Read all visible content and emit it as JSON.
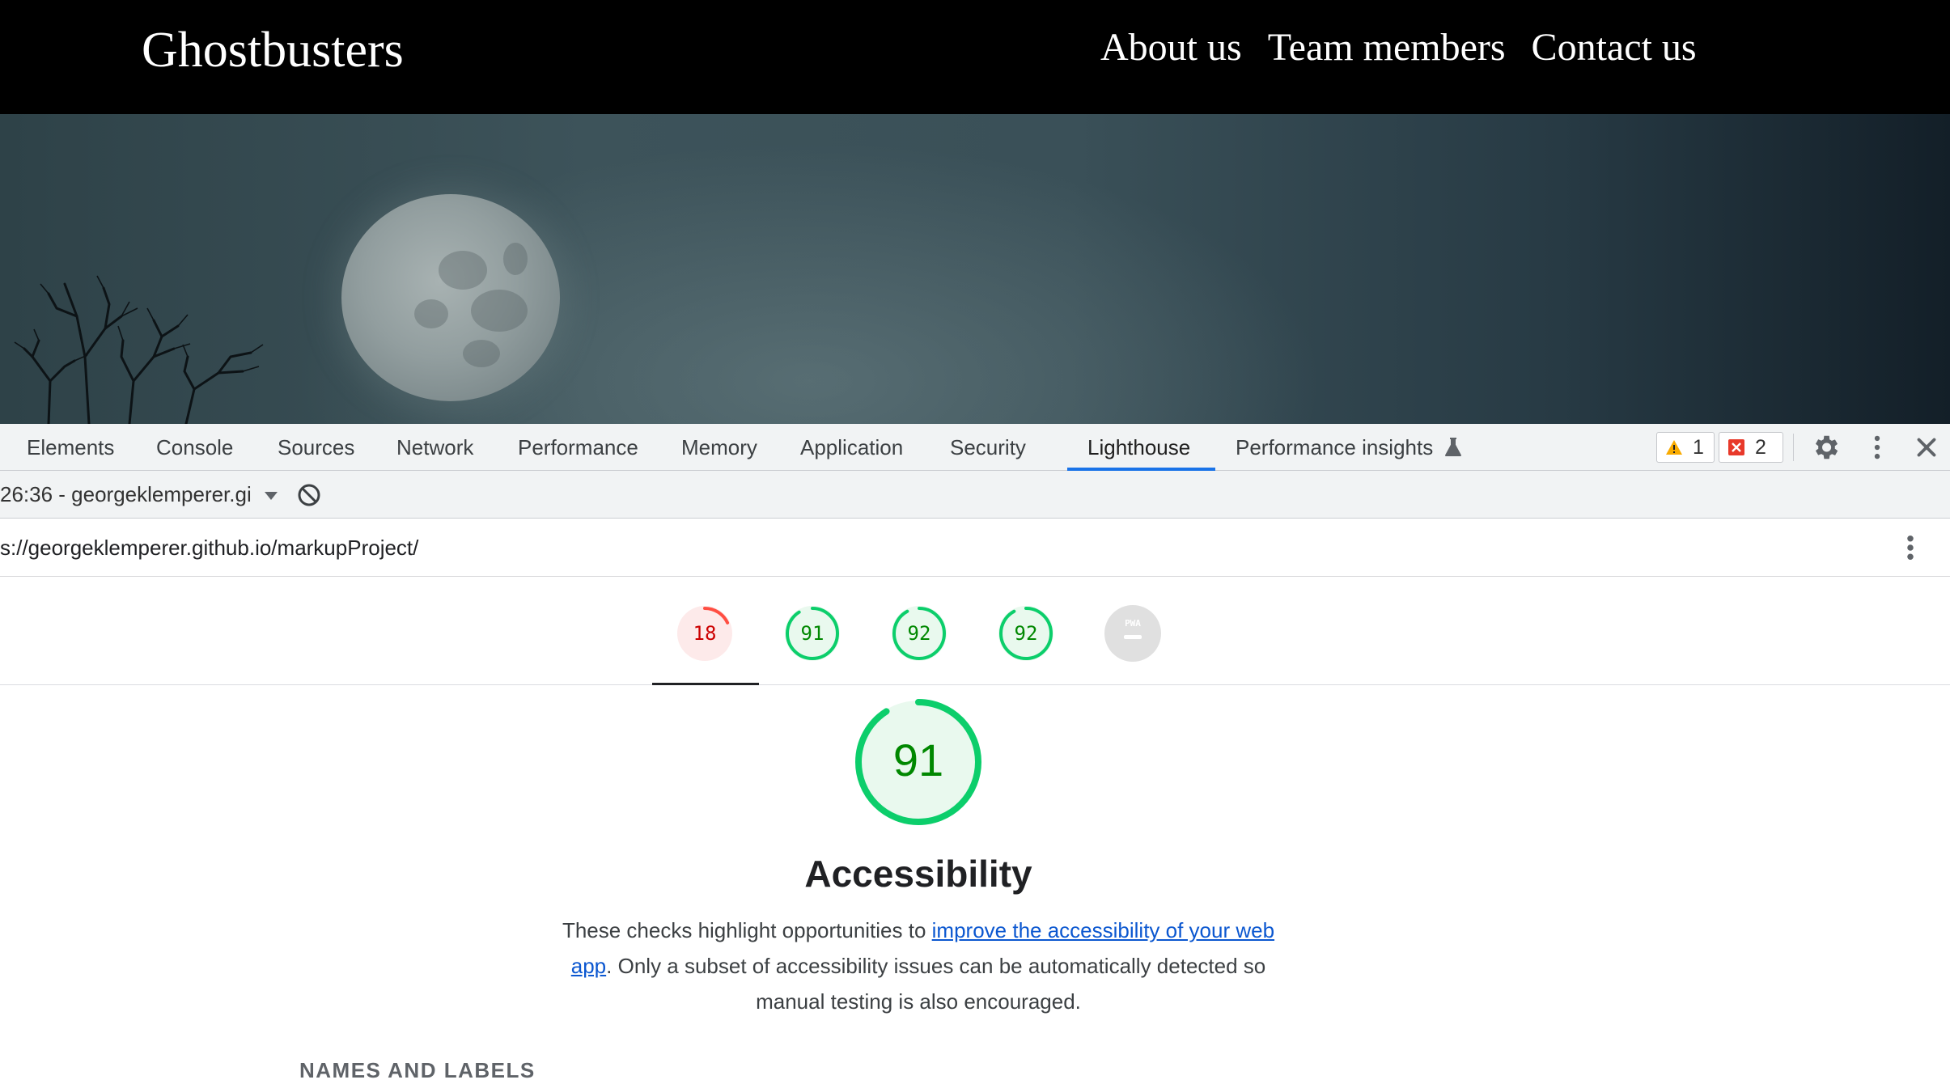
{
  "site": {
    "logo": "Ghostbusters",
    "nav": [
      "About us",
      "Team members",
      "Contact us"
    ]
  },
  "devtools": {
    "tabs": [
      "Elements",
      "Console",
      "Sources",
      "Network",
      "Performance",
      "Memory",
      "Application",
      "Security",
      "Lighthouse",
      "Performance insights"
    ],
    "active_tab": "Lighthouse",
    "warnings_count": "1",
    "errors_count": "2",
    "report_select": "26:36 - georgeklemperer.gi",
    "url": "s://georgeklemperer.github.io/markupProject/"
  },
  "lighthouse": {
    "scores": [
      {
        "label": "18",
        "value": 18,
        "status": "fail"
      },
      {
        "label": "91",
        "value": 91,
        "status": "pass"
      },
      {
        "label": "92",
        "value": 92,
        "status": "pass"
      },
      {
        "label": "92",
        "value": 92,
        "status": "pass"
      },
      {
        "label": "PWA",
        "value": null,
        "status": "na"
      }
    ],
    "main_score": "91",
    "main_score_value": 91,
    "category_title": "Accessibility",
    "description_before": "These checks highlight opportunities to ",
    "description_link": "improve the accessibility of your web app",
    "description_after": ". Only a subset of accessibility issues can be automatically detected so manual testing is also encouraged.",
    "section_title": "NAMES AND LABELS"
  },
  "colors": {
    "pass": "#0cce6b",
    "pass_text": "#008800",
    "pass_bg": "#e9f9ee",
    "fail": "#ff4e42",
    "fail_text": "#cc0000",
    "fail_bg": "#fdeaea",
    "na": "#e0e0e0",
    "accent": "#1a73e8"
  }
}
